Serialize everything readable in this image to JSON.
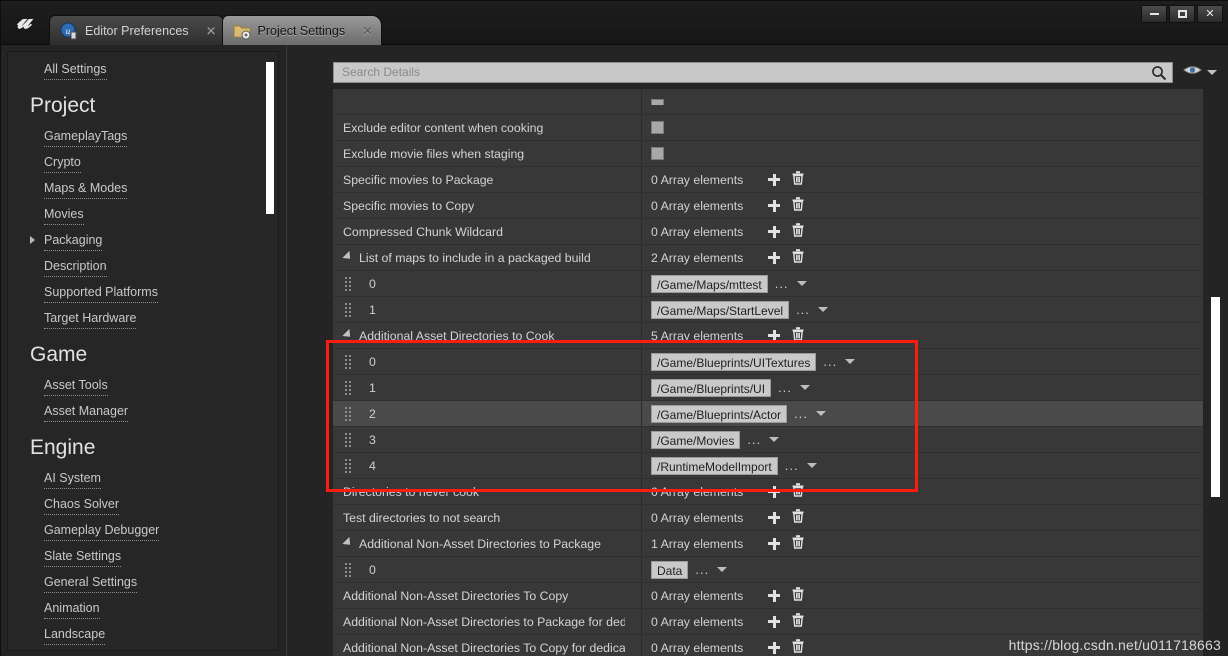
{
  "window": {
    "logo": "unreal-logo",
    "minimize_label": "—",
    "maximize_label": "▢",
    "close_label": "✕"
  },
  "tabs": [
    {
      "label": "Editor Preferences",
      "icon": "editor-preferences-icon",
      "close": "✕",
      "active": false
    },
    {
      "label": "Project Settings",
      "icon": "project-settings-folder-gear-icon",
      "close": "✕",
      "active": true
    }
  ],
  "sidebar": {
    "all_settings": "All Settings",
    "sections": [
      {
        "heading": "Project",
        "items": [
          {
            "label": "GameplayTags",
            "expandable": false
          },
          {
            "label": "Crypto",
            "expandable": false
          },
          {
            "label": "Maps & Modes",
            "expandable": false
          },
          {
            "label": "Movies",
            "expandable": false
          },
          {
            "label": "Packaging",
            "expandable": true
          },
          {
            "label": "Description",
            "expandable": false
          },
          {
            "label": "Supported Platforms",
            "expandable": false
          },
          {
            "label": "Target Hardware",
            "expandable": false
          }
        ]
      },
      {
        "heading": "Game",
        "items": [
          {
            "label": "Asset Tools",
            "expandable": false
          },
          {
            "label": "Asset Manager",
            "expandable": false
          }
        ]
      },
      {
        "heading": "Engine",
        "items": [
          {
            "label": "AI System",
            "expandable": false
          },
          {
            "label": "Chaos Solver",
            "expandable": false
          },
          {
            "label": "Gameplay Debugger",
            "expandable": false
          },
          {
            "label": "Slate Settings",
            "expandable": false
          },
          {
            "label": "General Settings",
            "expandable": false
          },
          {
            "label": "Animation",
            "expandable": false
          },
          {
            "label": "Landscape",
            "expandable": false
          }
        ]
      }
    ]
  },
  "search": {
    "placeholder": "Search Details",
    "value": "",
    "magnifier_icon": "search-icon",
    "view_options_icon": "eye-icon"
  },
  "details_rows": [
    {
      "type": "checkbox",
      "name": "",
      "cut": true
    },
    {
      "type": "checkbox",
      "name": "Exclude editor content when cooking",
      "checked": false
    },
    {
      "type": "checkbox",
      "name": "Exclude movie files when staging",
      "checked": false
    },
    {
      "type": "array",
      "name": "Specific movies to Package",
      "count": "0 Array elements"
    },
    {
      "type": "array",
      "name": "Specific movies to Copy",
      "count": "0 Array elements"
    },
    {
      "type": "array",
      "name": "Compressed Chunk Wildcard",
      "count": "0 Array elements"
    },
    {
      "type": "array",
      "name": "List of maps to include in a packaged build",
      "count": "2 Array elements",
      "expanded": true
    },
    {
      "type": "element",
      "name": "0",
      "value": "/Game/Maps/mttest"
    },
    {
      "type": "element",
      "name": "1",
      "value": "/Game/Maps/StartLevel"
    },
    {
      "type": "array",
      "name": "Additional Asset Directories to Cook",
      "count": "5 Array elements",
      "expanded": true,
      "highlighted": true
    },
    {
      "type": "element",
      "name": "0",
      "value": "/Game/Blueprints/UITextures",
      "highlighted": true
    },
    {
      "type": "element",
      "name": "1",
      "value": "/Game/Blueprints/UI",
      "highlighted": true
    },
    {
      "type": "element",
      "name": "2",
      "value": "/Game/Blueprints/Actor",
      "highlighted": true,
      "hover": true
    },
    {
      "type": "element",
      "name": "3",
      "value": "/Game/Movies",
      "highlighted": true
    },
    {
      "type": "element",
      "name": "4",
      "value": "/RuntimeModelImport",
      "highlighted": true
    },
    {
      "type": "array",
      "name": "Directories to never cook",
      "count": "0 Array elements"
    },
    {
      "type": "array",
      "name": "Test directories to not search",
      "count": "0 Array elements"
    },
    {
      "type": "array",
      "name": "Additional Non-Asset Directories to Package",
      "count": "1 Array elements",
      "expanded": true
    },
    {
      "type": "element",
      "name": "0",
      "value": "Data"
    },
    {
      "type": "array",
      "name": "Additional Non-Asset Directories To Copy",
      "count": "0 Array elements"
    },
    {
      "type": "array",
      "name": "Additional Non-Asset Directories to Package for dedica",
      "count": "0 Array elements"
    },
    {
      "type": "array",
      "name": "Additional Non-Asset Directories To Copy for dedicate",
      "count": "0 Array elements"
    }
  ],
  "row_controls": {
    "add_label": "+",
    "delete_label": "trash-icon",
    "browse_label": "...",
    "dropdown_label": "caret-down"
  },
  "watermark": "https://blog.csdn.net/u011718663",
  "colors": {
    "highlight_box": "#fc1d10",
    "panel_bg": "#383838",
    "accent_field": "#c9c9c9"
  }
}
